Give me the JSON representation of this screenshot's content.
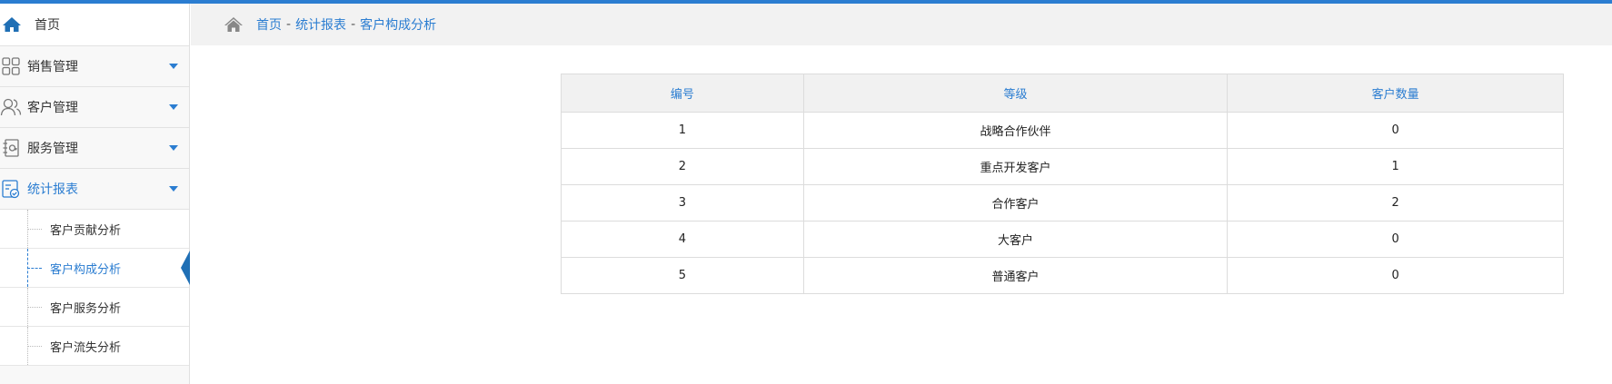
{
  "sidebar": {
    "home_label": "首页",
    "menu": [
      {
        "label": "销售管理",
        "icon": "grid-icon"
      },
      {
        "label": "客户管理",
        "icon": "users-icon"
      },
      {
        "label": "服务管理",
        "icon": "notebook-icon"
      },
      {
        "label": "统计报表",
        "icon": "report-icon",
        "active": true
      }
    ],
    "submenu": [
      {
        "label": "客户贡献分析"
      },
      {
        "label": "客户构成分析",
        "active": true
      },
      {
        "label": "客户服务分析"
      },
      {
        "label": "客户流失分析"
      }
    ]
  },
  "breadcrumb": [
    "首页",
    "统计报表",
    "客户构成分析"
  ],
  "breadcrumb_separator": "-",
  "table": {
    "headers": [
      "编号",
      "等级",
      "客户数量"
    ],
    "rows": [
      [
        "1",
        "战略合作伙伴",
        "0"
      ],
      [
        "2",
        "重点开发客户",
        "1"
      ],
      [
        "3",
        "合作客户",
        "2"
      ],
      [
        "4",
        "大客户",
        "0"
      ],
      [
        "5",
        "普通客户",
        "0"
      ]
    ]
  },
  "colors": {
    "accent": "#2b7dd1",
    "topbar": "#2b7dd1",
    "pointer": "#1f6fb5"
  }
}
